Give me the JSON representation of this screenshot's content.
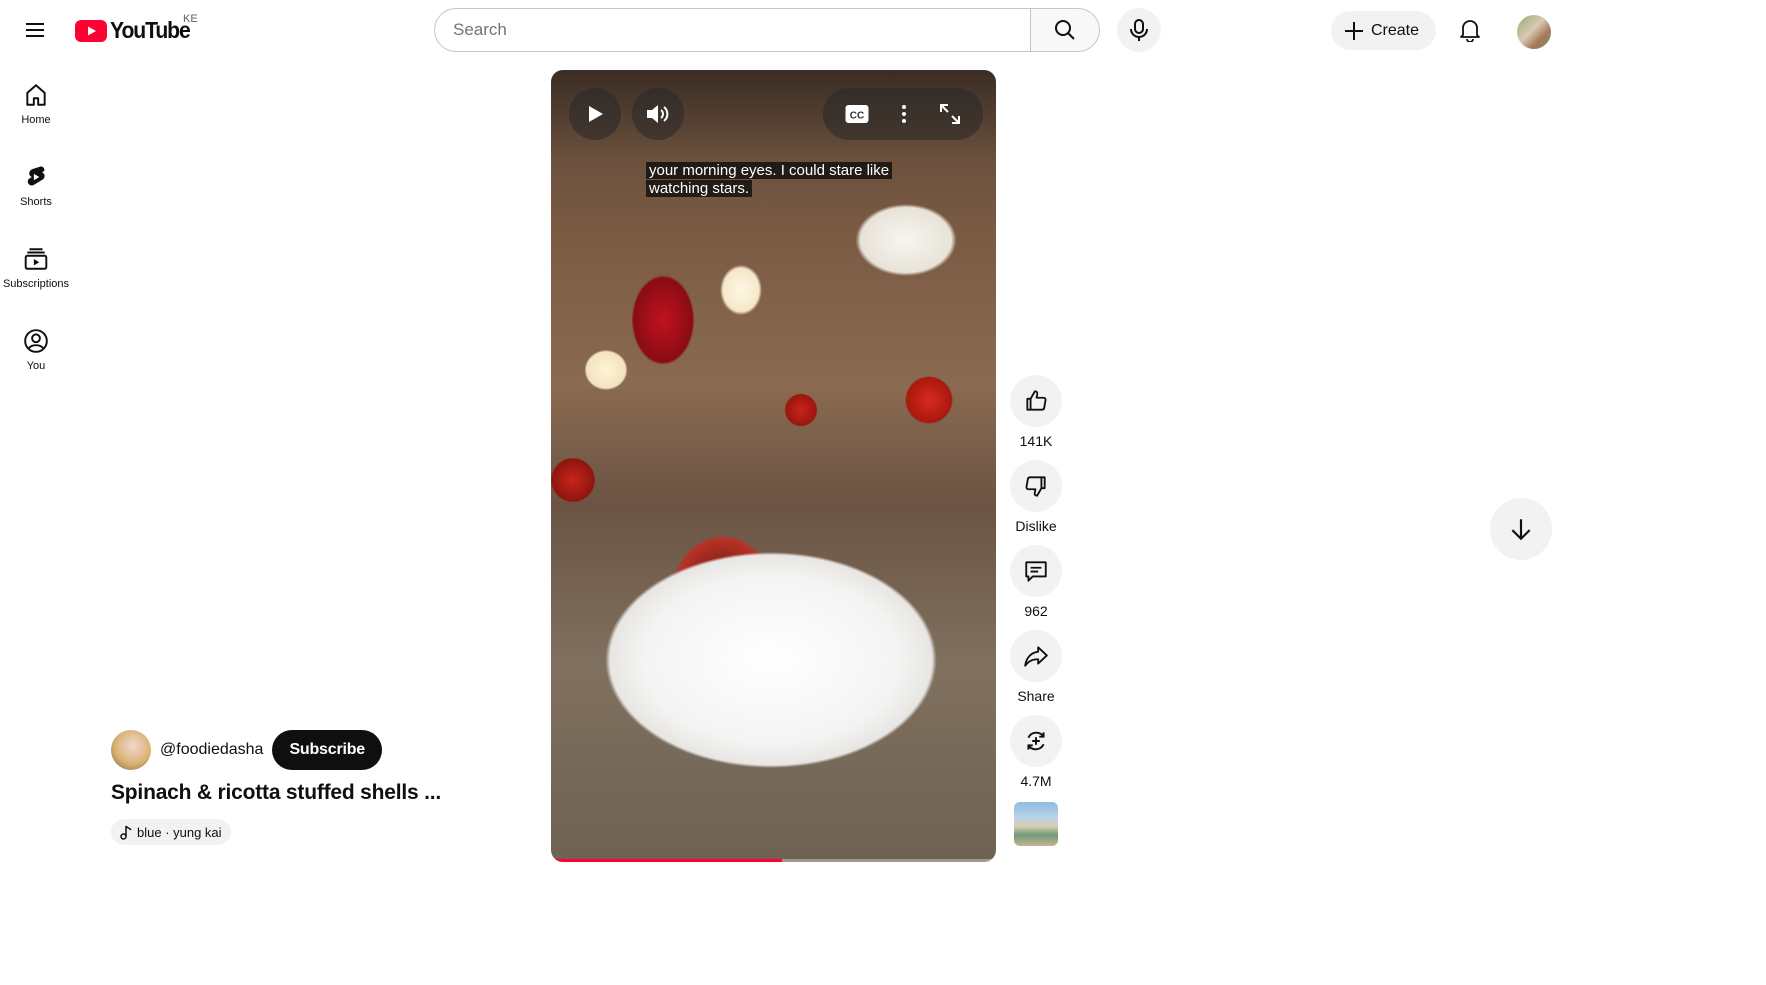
{
  "header": {
    "logo_text": "YouTube",
    "country_code": "KE",
    "search_placeholder": "Search",
    "create_label": "Create",
    "icons": [
      "hamburger-menu-icon",
      "youtube-logo-icon",
      "search-icon",
      "microphone-icon",
      "plus-icon",
      "bell-icon"
    ]
  },
  "sidebar": {
    "items": [
      {
        "label": "Home",
        "icon": "home-icon"
      },
      {
        "label": "Shorts",
        "icon": "shorts-icon"
      },
      {
        "label": "Subscriptions",
        "icon": "subscriptions-icon"
      },
      {
        "label": "You",
        "icon": "account-circle-icon"
      }
    ]
  },
  "video": {
    "caption_line1": "your morning eyes. I could stare like",
    "caption_line2": "watching stars.",
    "progress_fraction": 0.52,
    "controls": [
      "play-icon",
      "volume-icon",
      "closed-captions-icon",
      "more-vert-icon",
      "fullscreen-icon"
    ],
    "accent_color": "#ff0033"
  },
  "actions": {
    "like_count": "141K",
    "dislike_label": "Dislike",
    "comment_count": "962",
    "share_label": "Share",
    "remix_count": "4.7M"
  },
  "meta": {
    "channel_handle": "@foodiedasha",
    "subscribe_label": "Subscribe",
    "title": "Spinach & ricotta stuffed shells ...",
    "sound_label": "blue · yung kai"
  }
}
